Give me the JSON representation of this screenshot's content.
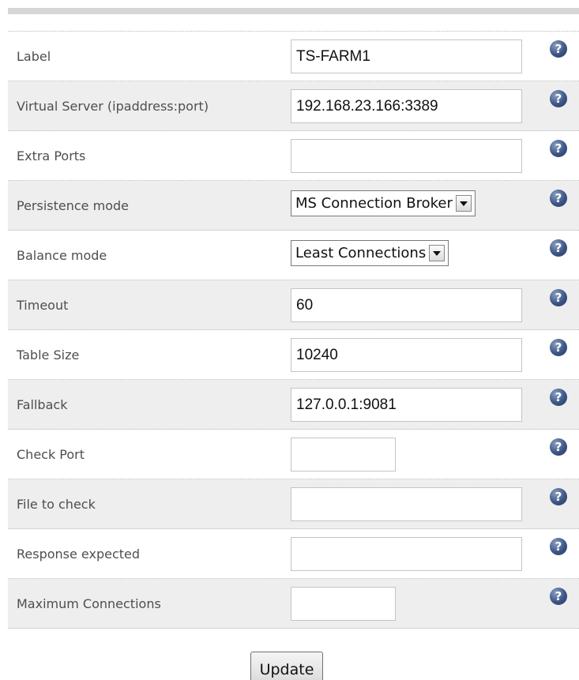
{
  "form": {
    "rows": [
      {
        "label": "Label",
        "type": "input",
        "value": "TS-FARM1",
        "width": "wide"
      },
      {
        "label": "Virtual Server (ipaddress:port)",
        "type": "input",
        "value": "192.168.23.166:3389",
        "width": "wide"
      },
      {
        "label": "Extra Ports",
        "type": "input",
        "value": "",
        "width": "wide"
      },
      {
        "label": "Persistence mode",
        "type": "select",
        "value": "MS Connection Broker"
      },
      {
        "label": "Balance mode",
        "type": "select",
        "value": "Least Connections"
      },
      {
        "label": "Timeout",
        "type": "input",
        "value": "60",
        "width": "wide"
      },
      {
        "label": "Table Size",
        "type": "input",
        "value": "10240",
        "width": "wide"
      },
      {
        "label": "Fallback",
        "type": "input",
        "value": "127.0.0.1:9081",
        "width": "wide"
      },
      {
        "label": "Check Port",
        "type": "input",
        "value": "",
        "width": "short"
      },
      {
        "label": "File to check",
        "type": "input",
        "value": "",
        "width": "wide"
      },
      {
        "label": "Response expected",
        "type": "input",
        "value": "",
        "width": "wide"
      },
      {
        "label": "Maximum Connections",
        "type": "input",
        "value": "",
        "width": "short"
      }
    ],
    "help_icon": {
      "icon": "help-question-icon",
      "glyph": "?"
    },
    "update_label": "Update"
  },
  "colors": {
    "row_alt": "#eeeeee",
    "label_text": "#4e4e4e",
    "help_icon": "#3c5585"
  }
}
